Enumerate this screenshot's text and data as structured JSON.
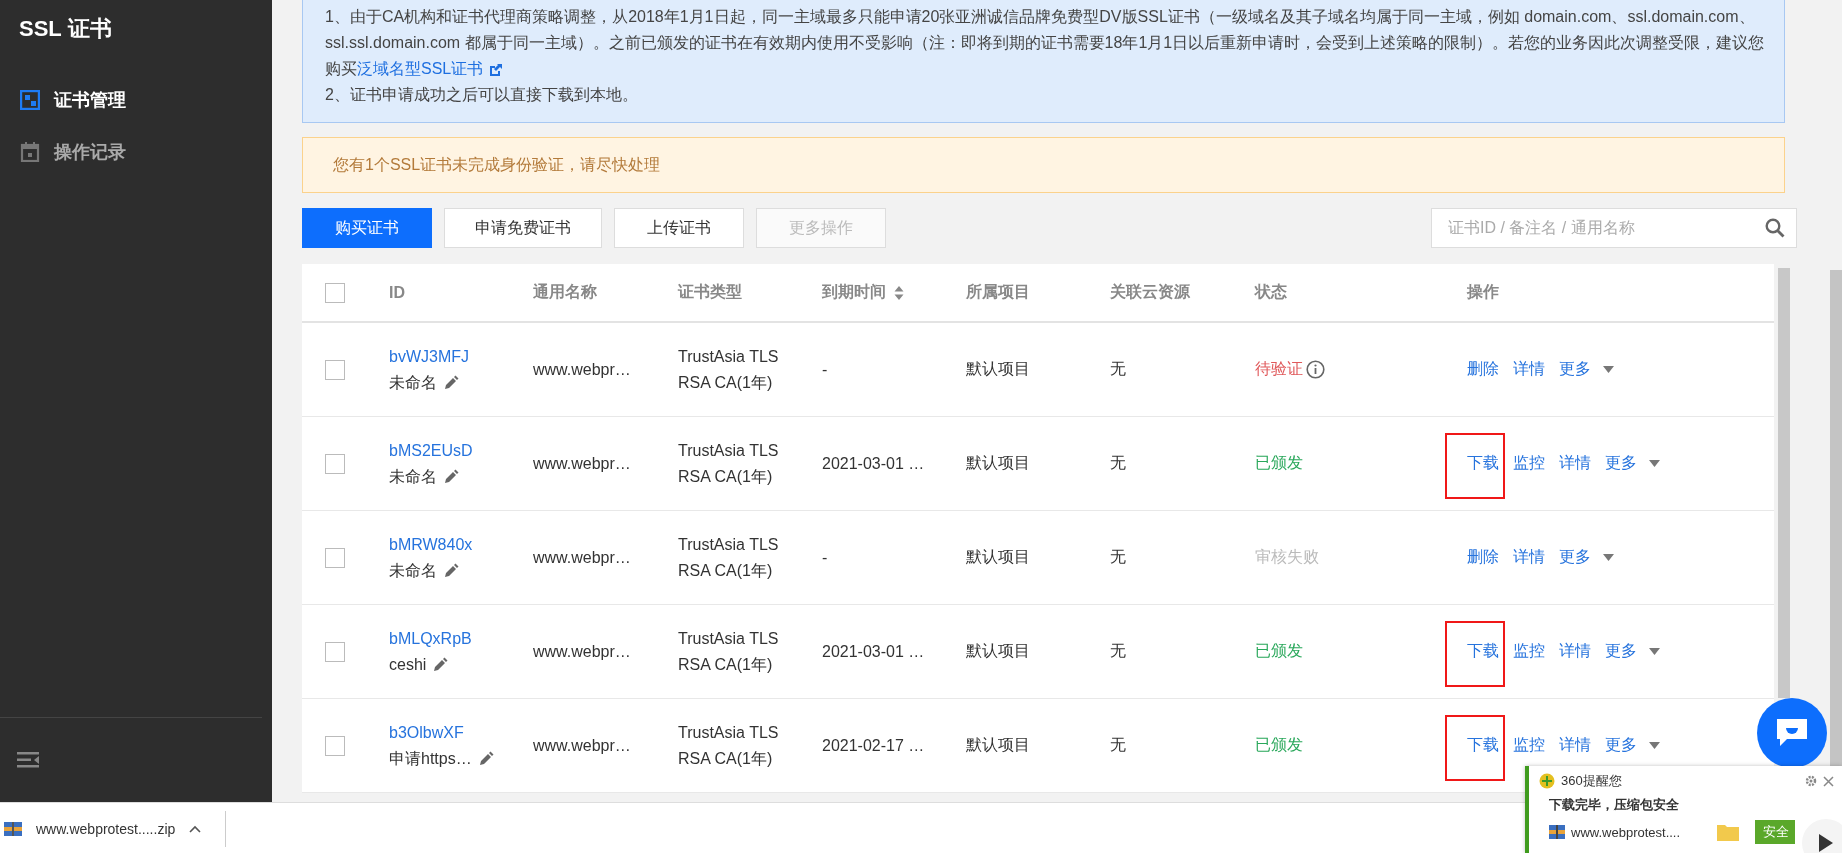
{
  "sidebar": {
    "title": "SSL 证书",
    "items": [
      {
        "label": "证书管理",
        "kind": "certificate",
        "selected": true
      },
      {
        "label": "操作记录",
        "kind": "calendar",
        "selected": false
      }
    ]
  },
  "notice": {
    "text": "1、由于CA机构和证书代理商策略调整，从2018年1月1日起，同一主域最多只能申请20张亚洲诚信品牌免费型DV版SSL证书（一级域名及其子域名均属于同一主域，例如 domain.com、ssl.domain.com、ssl.ssl.domain.com 都属于同一主域）。之前已颁发的证书在有效期内使用不受影响（注：即将到期的证书需要18年1月1日以后重新申请时，会受到上述策略的限制）。若您的业务因此次调整受限，建议您购买",
    "link": "泛域名型SSL证书",
    "item_2": "2、证书申请成功之后可以直接下载到本地。"
  },
  "warning": "您有1个SSL证书未完成身份验证，请尽快处理",
  "toolbar": {
    "buttons": [
      {
        "label": "购买证书",
        "kind": "primary",
        "disabled": false
      },
      {
        "label": "申请免费证书",
        "kind": "default",
        "disabled": false
      },
      {
        "label": "上传证书",
        "kind": "default",
        "disabled": false
      },
      {
        "label": "更多操作",
        "kind": "default",
        "disabled": true
      }
    ],
    "search": {
      "placeholder": "证书ID / 备注名 / 通用名称"
    }
  },
  "table": {
    "header_checked": false,
    "columns": [
      {
        "label": "ID",
        "sortable": false
      },
      {
        "label": "通用名称",
        "sortable": false
      },
      {
        "label": "证书类型",
        "sortable": false
      },
      {
        "label": "到期时间",
        "sortable": true
      },
      {
        "label": "所属项目",
        "sortable": false
      },
      {
        "label": "关联云资源",
        "sortable": false
      },
      {
        "label": "状态",
        "sortable": false
      },
      {
        "label": "操作",
        "sortable": false
      }
    ],
    "rows": [
      {
        "checked": false,
        "id": "bvWJ3MFJ",
        "remark": "未命名",
        "domain": "www.webpr…",
        "type": "TrustAsia TLS RSA CA(1年)",
        "expiry": "-",
        "project": "默认项目",
        "cloud": "无",
        "status": {
          "text": "待验证",
          "kind": "pending"
        },
        "highlight": false,
        "actions": [
          {
            "label": "删除",
            "kind": "link"
          },
          {
            "label": "详情",
            "kind": "link"
          },
          {
            "label": "更多",
            "kind": "dropdown"
          }
        ]
      },
      {
        "checked": false,
        "id": "bMS2EUsD",
        "remark": "未命名",
        "domain": "www.webpr…",
        "type": "TrustAsia TLS RSA CA(1年)",
        "expiry": "2021-03-01 …",
        "project": "默认项目",
        "cloud": "无",
        "status": {
          "text": "已颁发",
          "kind": "issued"
        },
        "highlight": true,
        "actions": [
          {
            "label": "下载",
            "kind": "link"
          },
          {
            "label": "监控",
            "kind": "link"
          },
          {
            "label": "详情",
            "kind": "link"
          },
          {
            "label": "更多",
            "kind": "dropdown"
          }
        ]
      },
      {
        "checked": false,
        "id": "bMRW840x",
        "remark": "未命名",
        "domain": "www.webpr…",
        "type": "TrustAsia TLS RSA CA(1年)",
        "expiry": "-",
        "project": "默认项目",
        "cloud": "无",
        "status": {
          "text": "审核失败",
          "kind": "failed"
        },
        "highlight": false,
        "actions": [
          {
            "label": "删除",
            "kind": "link"
          },
          {
            "label": "详情",
            "kind": "link"
          },
          {
            "label": "更多",
            "kind": "dropdown"
          }
        ]
      },
      {
        "checked": false,
        "id": "bMLQxRpB",
        "remark": "ceshi",
        "domain": "www.webpr…",
        "type": "TrustAsia TLS RSA CA(1年)",
        "expiry": "2021-03-01 …",
        "project": "默认项目",
        "cloud": "无",
        "status": {
          "text": "已颁发",
          "kind": "issued"
        },
        "highlight": true,
        "actions": [
          {
            "label": "下载",
            "kind": "link"
          },
          {
            "label": "监控",
            "kind": "link"
          },
          {
            "label": "详情",
            "kind": "link"
          },
          {
            "label": "更多",
            "kind": "dropdown"
          }
        ]
      },
      {
        "checked": false,
        "id": "b3OlbwXF",
        "remark": "申请https…",
        "domain": "www.webpr…",
        "type": "TrustAsia TLS RSA CA(1年)",
        "expiry": "2021-02-17 …",
        "project": "默认项目",
        "cloud": "无",
        "status": {
          "text": "已颁发",
          "kind": "issued"
        },
        "highlight": true,
        "actions": [
          {
            "label": "下载",
            "kind": "link"
          },
          {
            "label": "监控",
            "kind": "link"
          },
          {
            "label": "详情",
            "kind": "link"
          },
          {
            "label": "更多",
            "kind": "dropdown"
          }
        ]
      }
    ]
  },
  "popup": {
    "title": "360提醒您",
    "message": "下载完毕，压缩包安全",
    "file": "www.webprotest....",
    "button": "安全"
  },
  "download_shelf": {
    "file": "www.webprotest.....zip"
  }
}
